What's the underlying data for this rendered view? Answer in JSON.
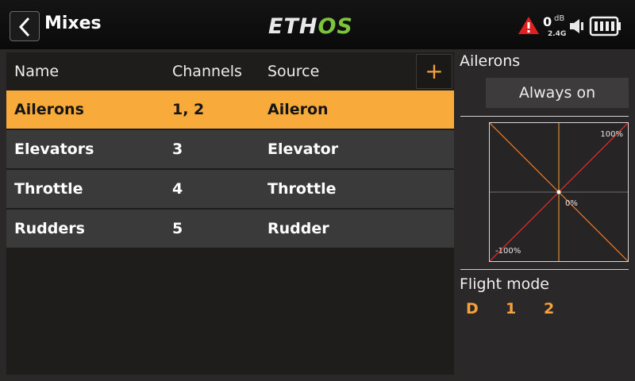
{
  "header": {
    "title": "Mixes",
    "logo_left": "ETH",
    "logo_right": "OS",
    "volume_value": "0",
    "volume_unit": "dB",
    "rf_band": "2.4G",
    "icons": [
      "chevron-left-icon",
      "warning-icon",
      "speaker-icon",
      "battery-icon"
    ]
  },
  "table": {
    "columns": [
      "Name",
      "Channels",
      "Source"
    ],
    "add_label": "+",
    "rows": [
      {
        "name": "Ailerons",
        "channels": "1, 2",
        "source": "Aileron",
        "selected": true
      },
      {
        "name": "Elevators",
        "channels": "3",
        "source": "Elevator",
        "selected": false
      },
      {
        "name": "Throttle",
        "channels": "4",
        "source": "Throttle",
        "selected": false
      },
      {
        "name": "Rudders",
        "channels": "5",
        "source": "Rudder",
        "selected": false
      }
    ]
  },
  "panel": {
    "title": "Ailerons",
    "active_condition": "Always on",
    "curve": {
      "top_label": "100%",
      "center_label": "0%",
      "bottom_label": "-100%"
    },
    "flight_mode_label": "Flight mode",
    "flight_modes": [
      "D",
      "1",
      "2"
    ]
  },
  "colors": {
    "accent": "#f8ab3b",
    "logo_green": "#7bc43c",
    "row_bg": "#3b3a3a",
    "table_bg": "#1f1c1c",
    "warning": "#e02020"
  }
}
